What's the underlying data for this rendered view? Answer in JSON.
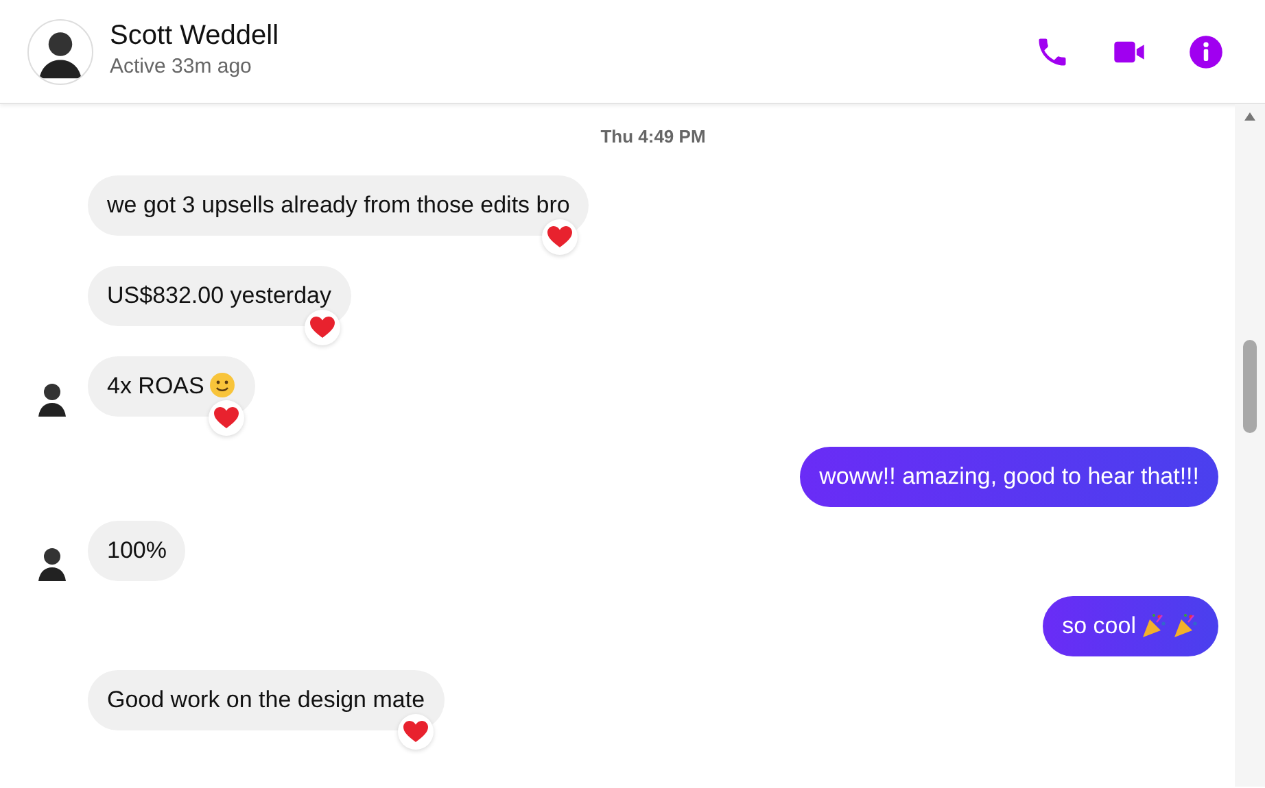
{
  "header": {
    "name": "Scott Weddell",
    "status": "Active 33m ago"
  },
  "timestamp": "Thu 4:49 PM",
  "messages": [
    {
      "kind": "incoming",
      "text": "we got 3 upsells already from those edits bro",
      "show_avatar": false,
      "reacted": true
    },
    {
      "kind": "incoming",
      "text": "US$832.00 yesterday",
      "show_avatar": false,
      "reacted": true
    },
    {
      "kind": "incoming",
      "text": "4x ROAS",
      "show_avatar": true,
      "reacted": true,
      "emojis": [
        {
          "kind": "smiley"
        }
      ]
    },
    {
      "kind": "outgoing",
      "text": "woww!! amazing, good to hear that!!!",
      "show_avatar": false,
      "reacted": false
    },
    {
      "kind": "incoming",
      "text": "100%",
      "show_avatar": true,
      "reacted": false
    },
    {
      "kind": "outgoing",
      "text": "so cool",
      "show_avatar": false,
      "reacted": false,
      "emojis": [
        {
          "kind": "party-popper"
        },
        {
          "kind": "party-popper"
        }
      ]
    },
    {
      "kind": "incoming",
      "text": "Good work on the design mate",
      "show_avatar": false,
      "reacted": true
    }
  ]
}
